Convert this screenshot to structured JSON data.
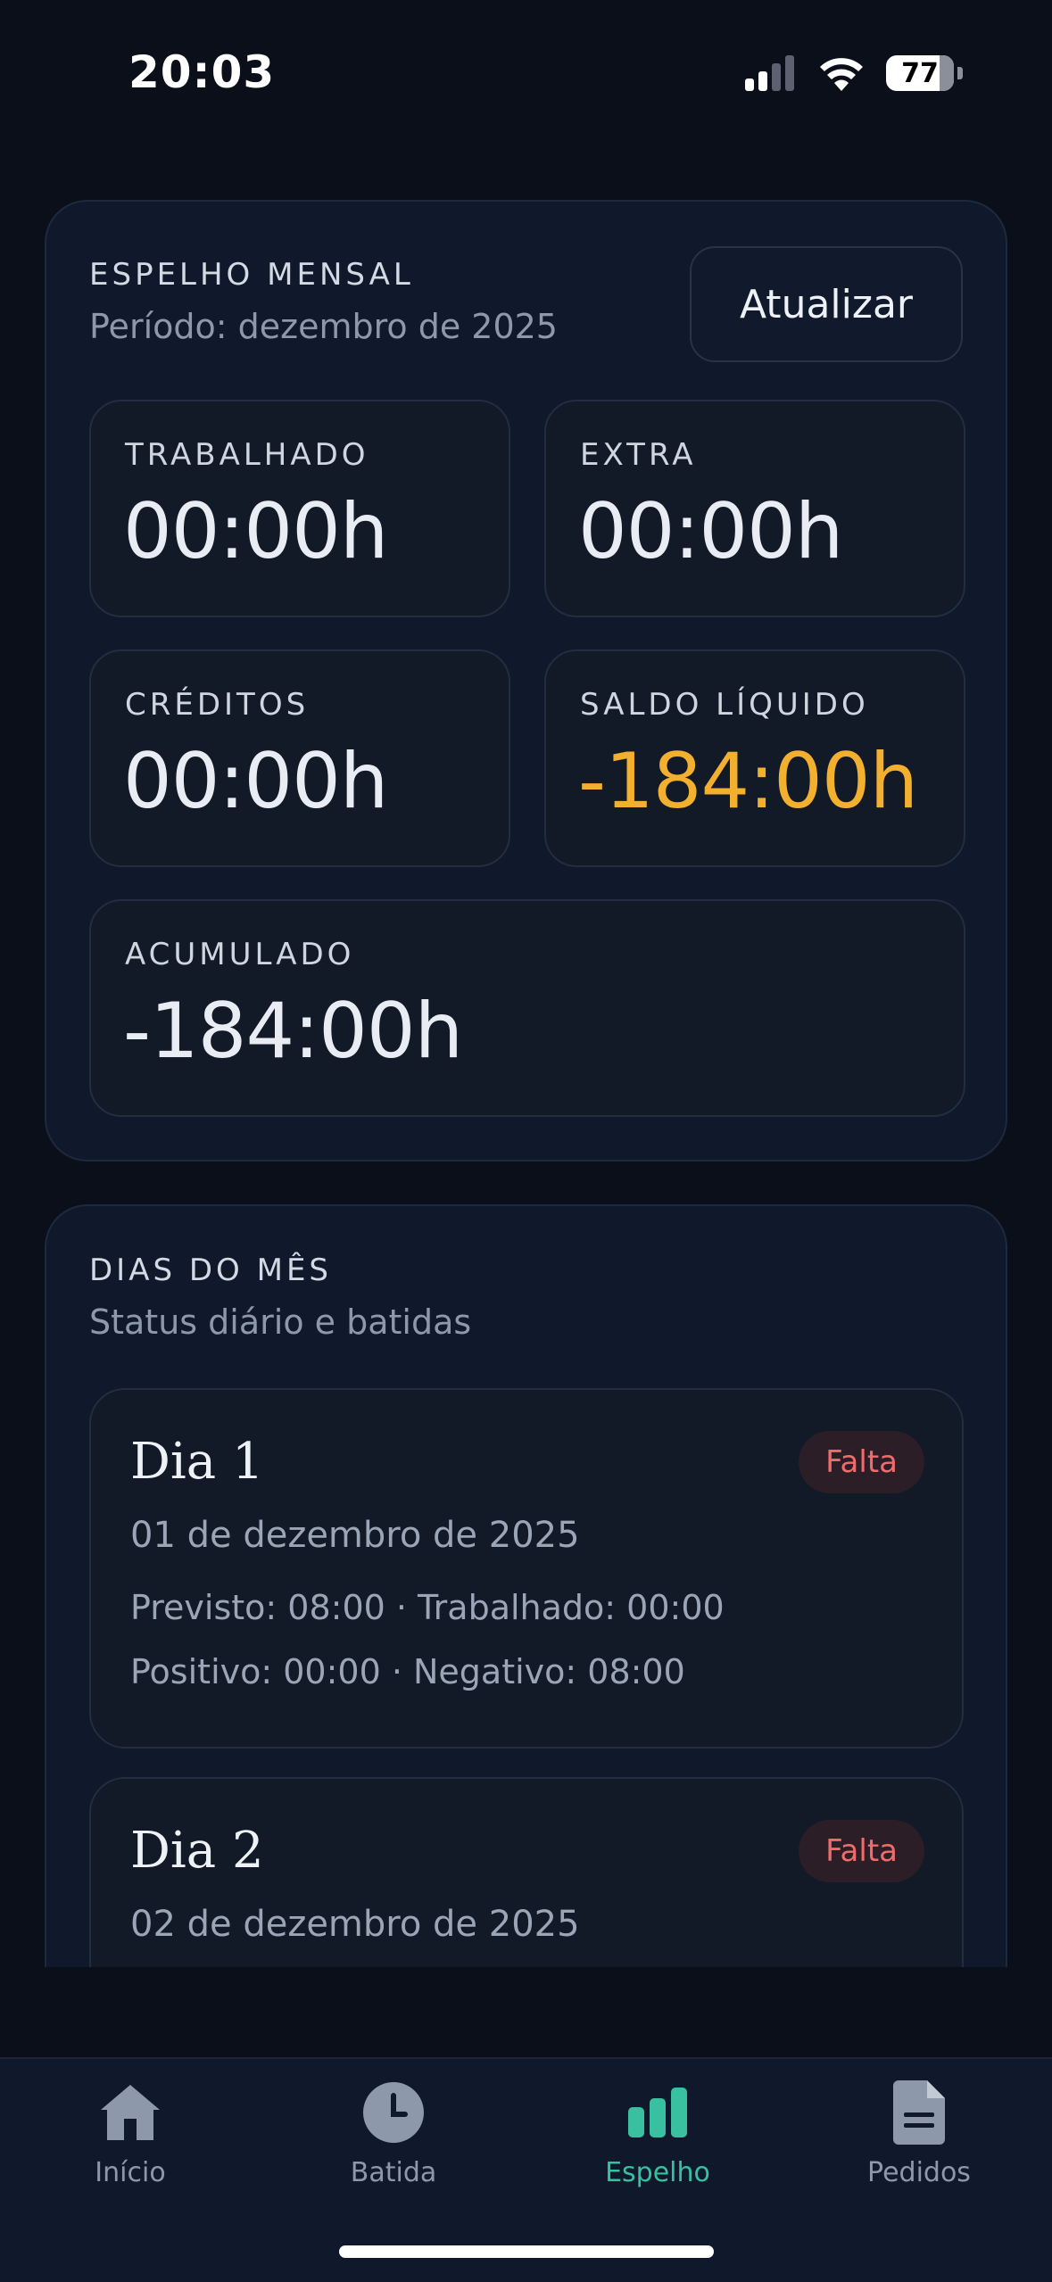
{
  "status_bar": {
    "time": "20:03",
    "battery": "77"
  },
  "summary": {
    "title": "ESPELHO MENSAL",
    "period": "Período: dezembro de 2025",
    "refresh_label": "Atualizar",
    "stats": {
      "worked": {
        "label": "TRABALHADO",
        "value": "00:00h"
      },
      "extra": {
        "label": "EXTRA",
        "value": "00:00h"
      },
      "credits": {
        "label": "CRÉDITOS",
        "value": "00:00h"
      },
      "net_balance": {
        "label": "SALDO LÍQUIDO",
        "value": "-184:00h"
      },
      "accumulated": {
        "label": "ACUMULADO",
        "value": "-184:00h"
      }
    },
    "warning_color": "#f3b02e"
  },
  "days_section": {
    "title": "DIAS DO MÊS",
    "subtitle": "Status diário e batidas",
    "days": [
      {
        "title": "Dia 1",
        "status": "Falta",
        "date": "01 de dezembro de 2025",
        "line1": "Previsto: 08:00 · Trabalhado: 00:00",
        "line2": "Positivo: 00:00 · Negativo: 08:00"
      },
      {
        "title": "Dia 2",
        "status": "Falta",
        "date": "02 de dezembro de 2025"
      }
    ],
    "status_color": "#f06b6b"
  },
  "tab_bar": {
    "active_color": "#38c0a0",
    "tabs": [
      {
        "label": "Início",
        "icon": "home-icon"
      },
      {
        "label": "Batida",
        "icon": "clock-icon"
      },
      {
        "label": "Espelho",
        "icon": "bar-chart-icon",
        "active": true
      },
      {
        "label": "Pedidos",
        "icon": "document-icon"
      }
    ]
  }
}
